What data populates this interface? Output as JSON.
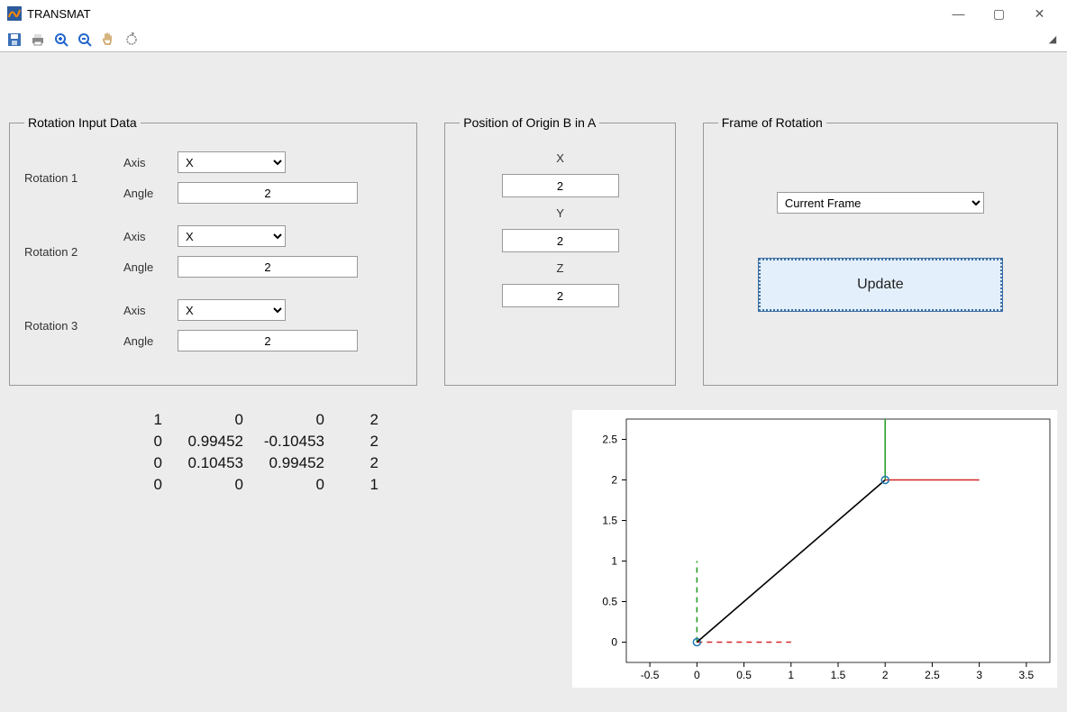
{
  "window": {
    "title": "TRANSMAT",
    "min": "—",
    "max": "▢",
    "close": "✕"
  },
  "panels": {
    "rotation_title": "Rotation Input Data",
    "position_title": "Position of Origin B in A",
    "frame_title": "Frame of Rotation"
  },
  "rotation": {
    "rows": [
      {
        "label": "Rotation 1",
        "axis_label": "Axis",
        "angle_label": "Angle",
        "axis": "X",
        "angle": "2"
      },
      {
        "label": "Rotation 2",
        "axis_label": "Axis",
        "angle_label": "Angle",
        "axis": "X",
        "angle": "2"
      },
      {
        "label": "Rotation 3",
        "axis_label": "Axis",
        "angle_label": "Angle",
        "axis": "X",
        "angle": "2"
      }
    ]
  },
  "position": {
    "x_label": "X",
    "x": "2",
    "y_label": "Y",
    "y": "2",
    "z_label": "Z",
    "z": "2"
  },
  "frame": {
    "select_value": "Current Frame",
    "update_label": "Update"
  },
  "matrix": {
    "rows": [
      [
        "1",
        "0",
        "0",
        "2"
      ],
      [
        "0",
        "0.99452",
        "-0.10453",
        "2"
      ],
      [
        "0",
        "0.10453",
        "0.99452",
        "2"
      ],
      [
        "0",
        "0",
        "0",
        "1"
      ]
    ]
  },
  "chart_data": {
    "type": "line",
    "xlim": [
      -0.75,
      3.75
    ],
    "ylim": [
      -0.25,
      2.75
    ],
    "xticks": [
      -0.5,
      0,
      0.5,
      1,
      1.5,
      2,
      2.5,
      3,
      3.5
    ],
    "yticks": [
      0,
      0.5,
      1,
      1.5,
      2,
      2.5
    ],
    "series": [
      {
        "name": "frame-A-x",
        "color": "#d62728",
        "style": "dash",
        "points": [
          [
            0,
            0
          ],
          [
            1,
            0
          ]
        ]
      },
      {
        "name": "frame-A-y",
        "color": "#2ca02c",
        "style": "dash",
        "points": [
          [
            0,
            0
          ],
          [
            0,
            1
          ]
        ]
      },
      {
        "name": "origin-A",
        "color": "#1f77b4",
        "style": "marker",
        "points": [
          [
            0,
            0
          ]
        ]
      },
      {
        "name": "link",
        "color": "#000000",
        "style": "solid",
        "points": [
          [
            0,
            0
          ],
          [
            2,
            2
          ]
        ]
      },
      {
        "name": "frame-B-x",
        "color": "#d62728",
        "style": "solid",
        "points": [
          [
            2,
            2
          ],
          [
            3,
            2
          ]
        ]
      },
      {
        "name": "frame-B-y",
        "color": "#2ca02c",
        "style": "solid",
        "points": [
          [
            2,
            2
          ],
          [
            2,
            3
          ]
        ]
      },
      {
        "name": "origin-B",
        "color": "#1f77b4",
        "style": "marker",
        "points": [
          [
            2,
            2
          ]
        ]
      }
    ]
  }
}
